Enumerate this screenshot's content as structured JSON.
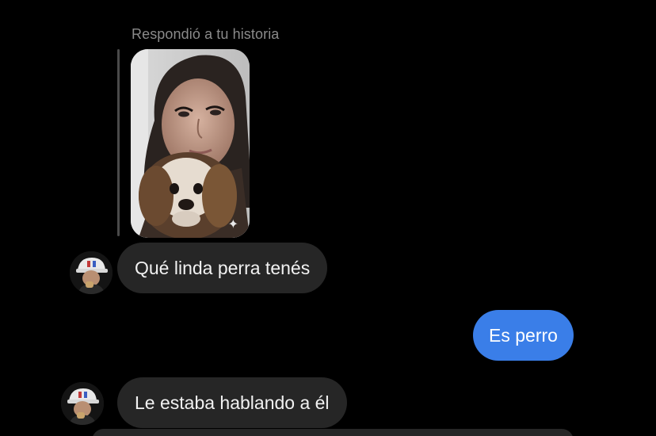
{
  "story_reply": {
    "label": "Respondió a tu historia",
    "sticker_icon": "sparkle-icon",
    "sticker_glyph": "✦"
  },
  "messages": [
    {
      "direction": "incoming",
      "text": "Qué linda perra tenés"
    },
    {
      "direction": "outgoing",
      "text": "Es perro"
    },
    {
      "direction": "incoming",
      "text": "Le estaba hablando a él"
    }
  ],
  "colors": {
    "background": "#000000",
    "incoming_bubble": "#262626",
    "outgoing_bubble": "#3a7ee8",
    "meta_text": "#8a8a8a"
  }
}
